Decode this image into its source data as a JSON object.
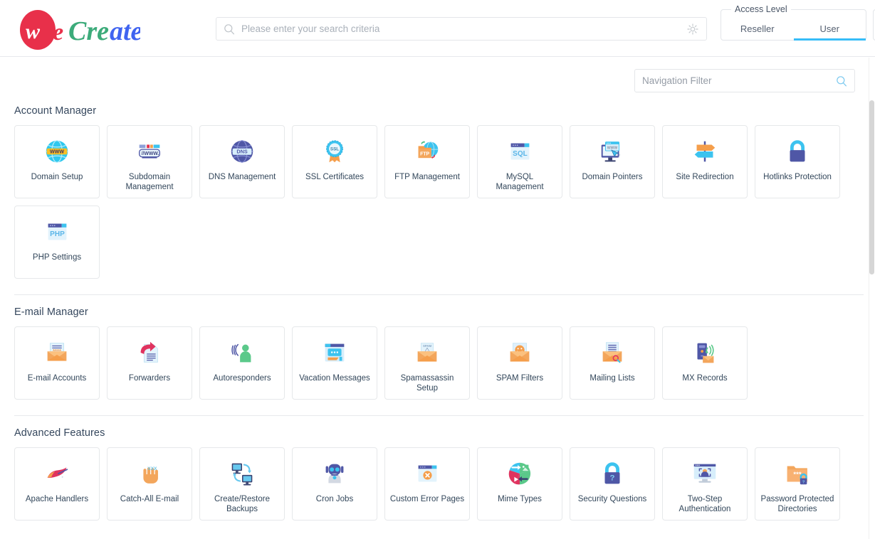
{
  "brand": {
    "logo_text": "weCreate",
    "logo_parts": [
      {
        "text": "w",
        "color": "#ffffff"
      },
      {
        "text": "e",
        "color": "#e8304a"
      },
      {
        "text": "Cre",
        "color": "#3cab7a"
      },
      {
        "text": "ate",
        "color": "#3f63f0"
      }
    ],
    "badge_color": "#e8304a"
  },
  "search": {
    "placeholder": "Please enter your search criteria",
    "value": "",
    "icon": "search-icon",
    "settings_icon": "gear-icon"
  },
  "access_level": {
    "legend": "Access Level",
    "tabs": [
      {
        "label": "Reseller",
        "active": false
      },
      {
        "label": "User",
        "active": true
      }
    ],
    "active_color": "#37bdf8"
  },
  "navigation_filter": {
    "placeholder": "Navigation Filter",
    "value": "",
    "icon": "search-icon"
  },
  "sections": [
    {
      "title": "Account Manager",
      "items": [
        {
          "label": "Domain Setup",
          "icon": "globe-www-icon"
        },
        {
          "label": "Subdomain Management",
          "icon": "subdomain-bar-icon"
        },
        {
          "label": "DNS Management",
          "icon": "dns-globe-icon"
        },
        {
          "label": "SSL Certificates",
          "icon": "ssl-badge-icon"
        },
        {
          "label": "FTP Management",
          "icon": "ftp-folder-icon"
        },
        {
          "label": "MySQL Management",
          "icon": "sql-window-icon"
        },
        {
          "label": "Domain Pointers",
          "icon": "monitor-www-icon"
        },
        {
          "label": "Site Redirection",
          "icon": "signpost-icon"
        },
        {
          "label": "Hotlinks Protection",
          "icon": "padlock-icon"
        },
        {
          "label": "PHP Settings",
          "icon": "php-window-icon"
        }
      ]
    },
    {
      "title": "E-mail Manager",
      "items": [
        {
          "label": "E-mail Accounts",
          "icon": "envelope-password-icon"
        },
        {
          "label": "Forwarders",
          "icon": "forward-document-icon"
        },
        {
          "label": "Autoresponders",
          "icon": "person-broadcast-icon"
        },
        {
          "label": "Vacation Messages",
          "icon": "chat-window-icon"
        },
        {
          "label": "Spamassassin Setup",
          "icon": "envelope-spam-icon"
        },
        {
          "label": "SPAM Filters",
          "icon": "envelope-smiley-icon"
        },
        {
          "label": "Mailing Lists",
          "icon": "envelope-list-icon"
        },
        {
          "label": "MX Records",
          "icon": "server-mail-icon"
        }
      ]
    },
    {
      "title": "Advanced Features",
      "items": [
        {
          "label": "Apache Handlers",
          "icon": "feather-icon"
        },
        {
          "label": "Catch-All E-mail",
          "icon": "hand-catch-icon"
        },
        {
          "label": "Create/Restore Backups",
          "icon": "two-monitors-sync-icon"
        },
        {
          "label": "Cron Jobs",
          "icon": "robot-icon"
        },
        {
          "label": "Custom Error Pages",
          "icon": "window-error-icon"
        },
        {
          "label": "Mime Types",
          "icon": "mime-circle-icon"
        },
        {
          "label": "Security Questions",
          "icon": "padlock-question-icon"
        },
        {
          "label": "Two-Step Authentication",
          "icon": "monitor-face-id-icon"
        },
        {
          "label": "Password Protected Directories",
          "icon": "folder-lock-icon"
        }
      ]
    }
  ],
  "scrollbar": {
    "orientation": "vertical",
    "thumb_color": "#d6d6d6"
  }
}
